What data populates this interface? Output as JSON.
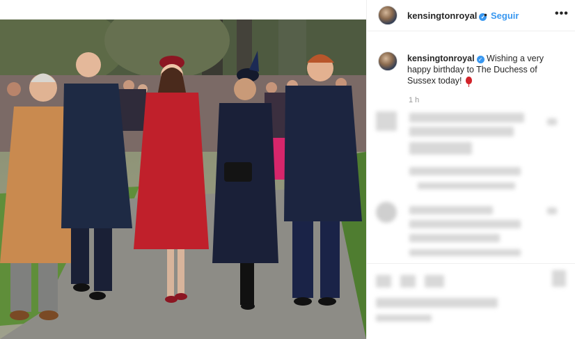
{
  "header": {
    "username": "kensingtonroyal",
    "separator": "•",
    "follow_label": "Seguir",
    "more_label": "•••",
    "verified_icon": "verified-badge-icon"
  },
  "caption": {
    "username": "kensingtonroyal",
    "text": "Wishing a very happy birthday to The Duchess of Sussex today!",
    "emoji_icon": "balloon-icon"
  },
  "timestamp": "1 h",
  "colors": {
    "accent": "#3897f0",
    "text": "#262626",
    "muted": "#999999",
    "border": "#efefef"
  }
}
